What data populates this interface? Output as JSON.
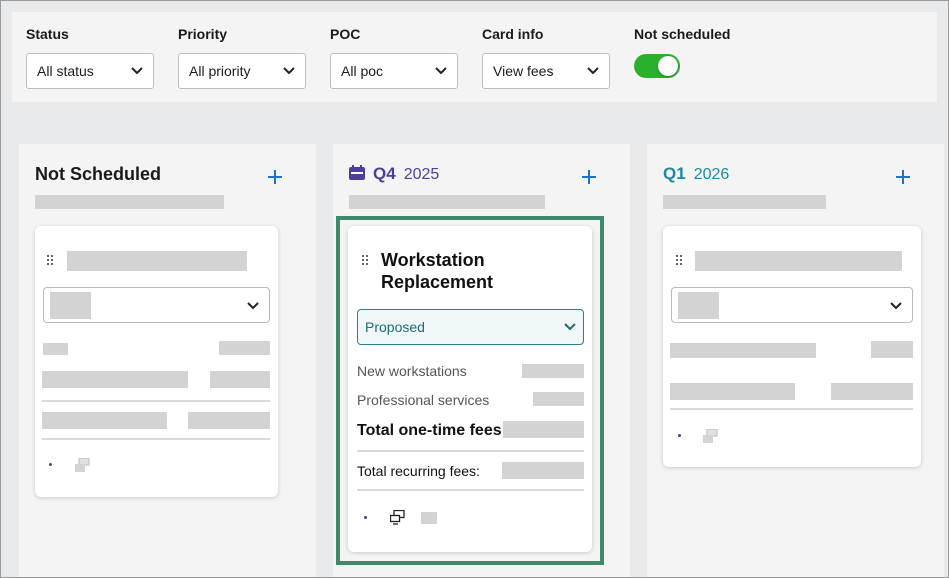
{
  "filters": [
    {
      "label": "Status",
      "value": "All status"
    },
    {
      "label": "Priority",
      "value": "All priority"
    },
    {
      "label": "POC",
      "value": "All poc"
    },
    {
      "label": "Card info",
      "value": "View fees"
    }
  ],
  "toggle": {
    "label": "Not scheduled",
    "on": true
  },
  "columns": {
    "not_scheduled": {
      "title": "Not Scheduled"
    },
    "q4": {
      "quarter": "Q4",
      "year": "2025"
    },
    "q1": {
      "quarter": "Q1",
      "year": "2026"
    }
  },
  "card": {
    "title_line1": "Workstation",
    "title_line2": "Replacement",
    "status": "Proposed",
    "fees": {
      "new_workstations": "New workstations",
      "professional_services": "Professional services",
      "total_one_time": "Total one-time fees:",
      "total_recurring": "Total recurring fees:"
    }
  },
  "colors": {
    "accent_blue": "#1f72c7",
    "q4_purple": "#4b3f9a",
    "q1_teal": "#1c8a9e",
    "toggle_green": "#2bb02b",
    "highlight_green": "#3e8a6b"
  }
}
